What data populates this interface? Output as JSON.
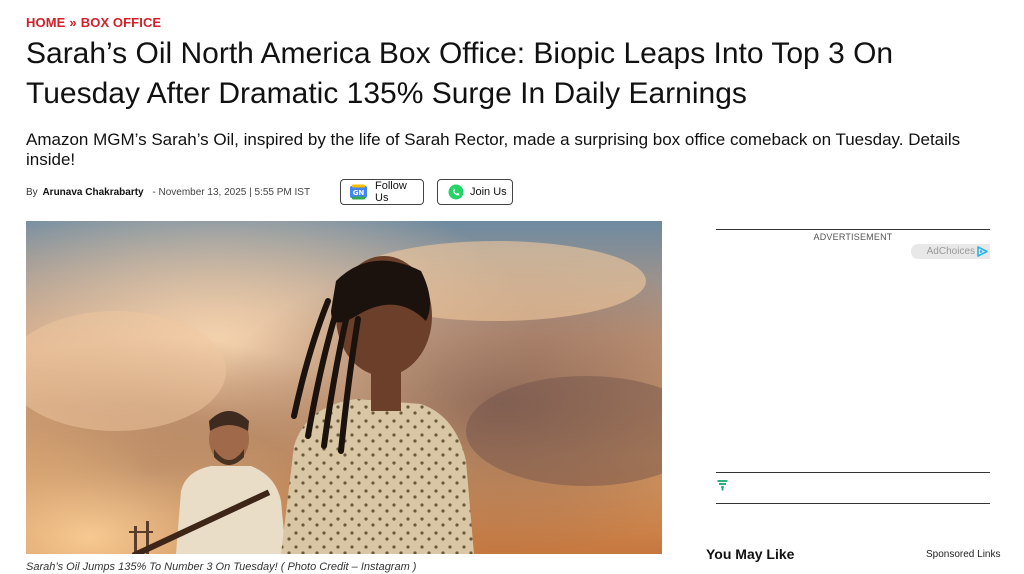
{
  "breadcrumb": {
    "home": "HOME",
    "separator": "»",
    "section": "BOX OFFICE"
  },
  "article": {
    "headline": "Sarah’s Oil North America Box Office: Biopic Leaps Into Top 3 On Tuesday After Dramatic 135% Surge In Daily Earnings",
    "subhead": "Amazon MGM’s Sarah’s Oil, inspired by the life of Sarah Rector, made a surprising box office comeback on Tuesday. Details inside!",
    "byline_prefix": "By",
    "author": "Arunava Chakrabarty",
    "date": "- November 13, 2025 | 5:55 PM IST",
    "image_caption": "Sarah’s Oil Jumps 135% To Number 3 On Tuesday! ( Photo Credit – Instagram )"
  },
  "social": {
    "follow_label": "Follow Us",
    "follow_icon": "google-news-icon",
    "join_label": "Join Us",
    "join_icon": "whatsapp-icon"
  },
  "sidebar": {
    "ad_label": "ADVERTISEMENT",
    "adchoices_label": "AdChoices",
    "you_may_like": "You May Like",
    "sponsored_links": "Sponsored Links"
  },
  "colors": {
    "accent": "#d0202a",
    "whatsapp": "#25d366",
    "adchoices": "#25b5e6"
  }
}
